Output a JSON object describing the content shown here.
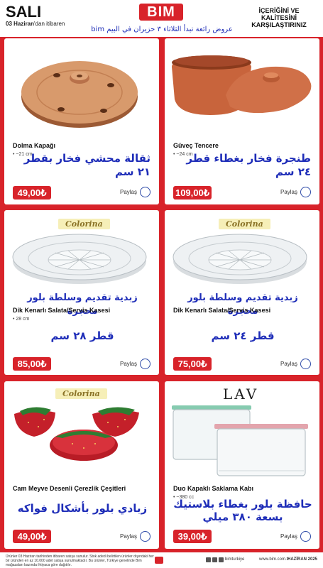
{
  "header": {
    "day": "SALI",
    "date_strong": "03 Haziran",
    "date_rest": "'dan itibaren",
    "logo": "BIM",
    "arabic_offer": "عروض رائعة تبدأ الثلاثاء ٣ حزيران في البيم bim",
    "right_text": "İÇERİĞİNİ VE KALİTESİNİ KARŞILAŞTIRINIZ"
  },
  "share_label": "Paylaş",
  "brand_colorina": "Colorina",
  "brand_lav": "LAV",
  "products": [
    {
      "name": "Dolma Kapağı",
      "size": "• ~21 cm",
      "arabic": "ثقالة محشي فخار بقطر ٢١ سم",
      "price": "49,00₺"
    },
    {
      "name": "Güveç Tencere",
      "size": "• ~24 cm",
      "arabic": "طنجرة فخار بغطاء قطر ٢٤ سم",
      "price": "109,00₺"
    },
    {
      "name": "Dik Kenarlı Salata/Servis Kasesi",
      "size": "• 28 cm",
      "arabic_top": "زبدية تقديم وسلطة بلور محجرة",
      "arabic": "قطر ٢٨ سم",
      "price": "85,00₺"
    },
    {
      "name": "Dik Kenarlı Salata/Servis Kasesi",
      "size": "",
      "arabic_top": "زبدية تقديم وسلطة بلور محجرة",
      "arabic": "قطر ٢٤ سم",
      "price": "75,00₺"
    },
    {
      "name": "Cam Meyve Desenli Çerezlik Çeşitleri",
      "size": "",
      "arabic": "زبادي بلور بأشكال فواكه",
      "price": "49,00₺"
    },
    {
      "name": "Duo Kapaklı Saklama Kabı",
      "size": "• ~380 cc",
      "arabic": "حافظة بلور بغطاء بلاستيك بسعة ٣٨٠ ميلي",
      "price": "39,00₺"
    }
  ],
  "footer": {
    "note": "Ürünler 03 Haziran tarihinden itibaren satışa sunulur. Stok adedi belirtilen ürünler dışındaki her bir üründen en az 10.000 adet satışa sunulmaktadır. Bu ürünler, Türkiye genelinde Bim mağazaları bazında ihtiyaca göre dağıtılır.",
    "handle": "bimturkiye",
    "site": "www.bim.com.tr",
    "date": "HAZİRAN 2025"
  },
  "colors": {
    "brand_red": "#d8232a",
    "arabic_blue": "#1e2db8"
  }
}
